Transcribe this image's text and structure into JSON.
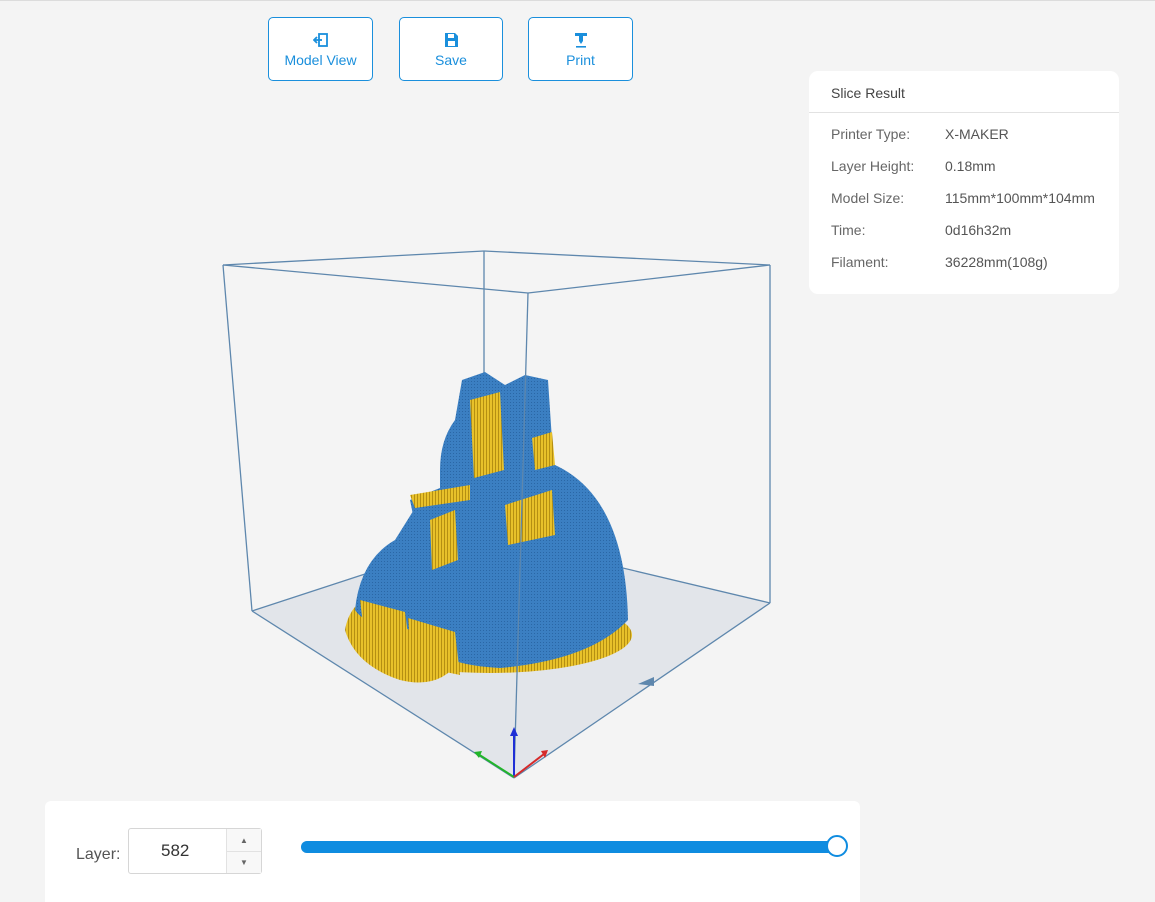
{
  "toolbar": {
    "model_view_label": "Model View",
    "save_label": "Save",
    "print_label": "Print",
    "accent_color": "#1a8fdc"
  },
  "slice_result": {
    "title": "Slice Result",
    "rows": [
      {
        "key": "Printer Type:",
        "value": "X-MAKER"
      },
      {
        "key": "Layer Height:",
        "value": "0.18mm"
      },
      {
        "key": "Model Size:",
        "value": "115mm*100mm*104mm"
      },
      {
        "key": "Time:",
        "value": "0d16h32m"
      },
      {
        "key": "Filament:",
        "value": "36228mm(108g)"
      }
    ]
  },
  "layer_control": {
    "label": "Layer:",
    "value": "582",
    "slider_fraction": 1.0
  },
  "model_colors": {
    "outer_wall": "#3b7fc2",
    "support": "#e8c12a"
  }
}
